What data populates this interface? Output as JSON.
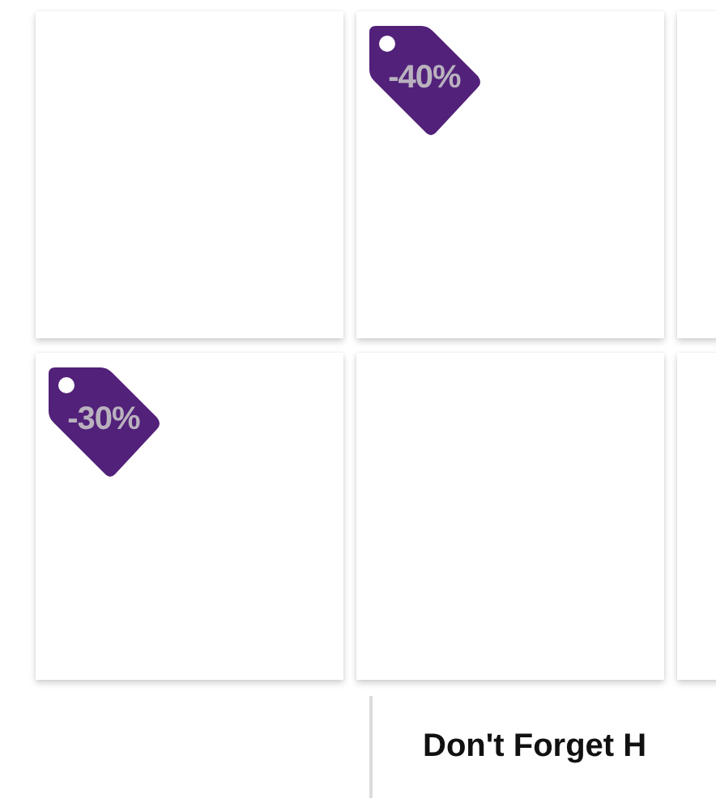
{
  "products": [
    {
      "kind": "card"
    },
    {
      "kind": "card",
      "badge": "-40%"
    },
    {
      "kind": "card"
    },
    {
      "kind": "card",
      "badge": "-30%"
    },
    {
      "kind": "card"
    },
    {
      "kind": "card"
    }
  ],
  "section_heading": "Don't Forget H"
}
